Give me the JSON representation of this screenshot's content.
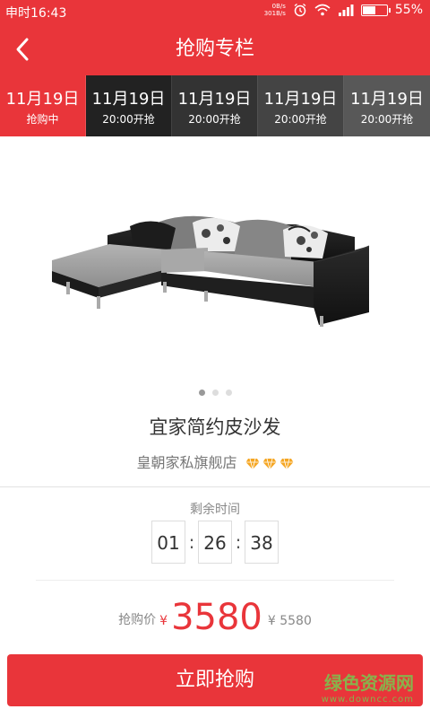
{
  "status_bar": {
    "time": "申时16:43",
    "net_up": "0B/s",
    "net_down": "301B/s",
    "battery": "55%",
    "battery_level": 0.55
  },
  "header": {
    "title": "抢购专栏",
    "back_icon": "chevron-left-icon"
  },
  "tabs": [
    {
      "date": "11月19日",
      "sub": "抢购中",
      "bg": "#e9353a",
      "active": true
    },
    {
      "date": "11月19日",
      "sub": "20:00开抢",
      "bg": "#222222"
    },
    {
      "date": "11月19日",
      "sub": "20:00开抢",
      "bg": "#333333"
    },
    {
      "date": "11月19日",
      "sub": "20:00开抢",
      "bg": "#444444"
    },
    {
      "date": "11月19日",
      "sub": "20:00开抢",
      "bg": "#585858"
    }
  ],
  "carousel": {
    "count": 3,
    "active": 0
  },
  "product": {
    "name": "宜家简约皮沙发",
    "shop": "皇朝家私旗舰店",
    "shop_rating_icons": [
      "diamond-icon",
      "diamond-icon",
      "diamond-icon"
    ]
  },
  "countdown": {
    "label": "剩余时间",
    "hours": "01",
    "minutes": "26",
    "seconds": "38",
    "separator": ":"
  },
  "price": {
    "label": "抢购价",
    "currency": "¥",
    "current": "3580",
    "original": "¥ 5580"
  },
  "buy_button": {
    "label": "立即抢购"
  },
  "watermark": {
    "line1": "绿色资源网",
    "line2": "www.downcc.com"
  },
  "colors": {
    "accent": "#e9353a",
    "gem": "#f5a623"
  }
}
